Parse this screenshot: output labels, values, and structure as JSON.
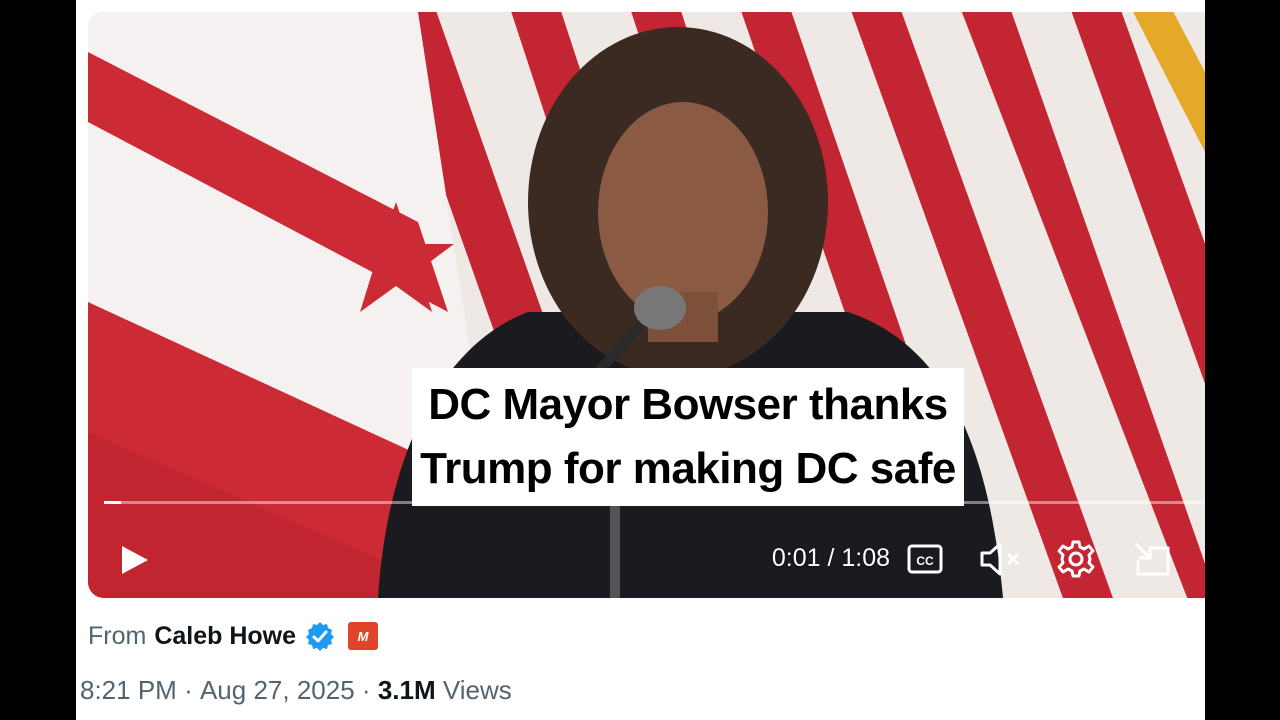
{
  "video": {
    "caption_line1": "DC Mayor Bowser thanks",
    "caption_line2": "Trump for making DC safe",
    "current_time": "0:01",
    "duration": "1:08",
    "time_display": "0:01 / 1:08",
    "progress_fraction": 0.015
  },
  "controls": {
    "play_icon": "play-icon",
    "cc_icon": "closed-captions-icon",
    "cc_label": "CC",
    "mute_icon": "muted-speaker-icon",
    "settings_icon": "gear-icon",
    "exit_icon": "exit-fullscreen-icon"
  },
  "meta": {
    "from_label": "From",
    "author": "Caleb Howe",
    "time": "8:21 PM",
    "separator": "·",
    "date": "Aug 27, 2025",
    "views_count": "3.1M",
    "views_label": "Views"
  },
  "colors": {
    "flag_red": "#c8202f",
    "verified_blue": "#1d9bf0",
    "affiliate_orange": "#e0452a",
    "meta_gray": "#536471",
    "text_dark": "#0f1419"
  }
}
